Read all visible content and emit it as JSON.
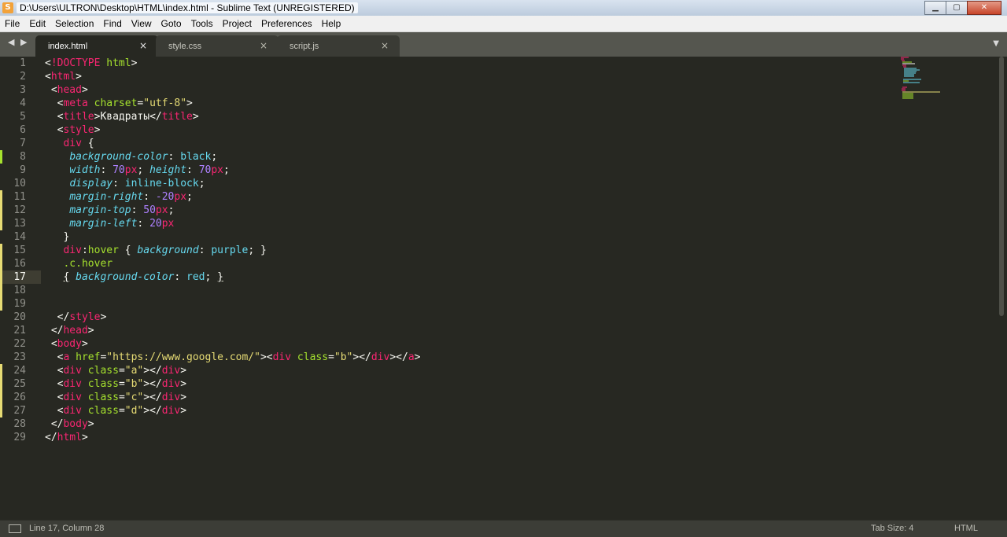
{
  "window": {
    "title": "D:\\Users\\ULTRON\\Desktop\\HTML\\index.html - Sublime Text (UNREGISTERED)",
    "minimize": "▁",
    "maximize": "▢",
    "close": "✕",
    "app_icon": "S"
  },
  "menu": [
    "File",
    "Edit",
    "Selection",
    "Find",
    "View",
    "Goto",
    "Tools",
    "Project",
    "Preferences",
    "Help"
  ],
  "tabs": [
    {
      "label": "index.html",
      "close": "×",
      "active": true
    },
    {
      "label": "style.css",
      "close": "×",
      "active": false
    },
    {
      "label": "script.js",
      "close": "×",
      "active": false
    }
  ],
  "tab_nav": "◀ ▶",
  "tab_dropdown": "▼",
  "editor": {
    "line_numbers": [
      "1",
      "2",
      "3",
      "4",
      "5",
      "6",
      "7",
      "8",
      "9",
      "10",
      "11",
      "12",
      "13",
      "14",
      "15",
      "16",
      "17",
      "18",
      "19",
      "20",
      "21",
      "22",
      "23",
      "24",
      "25",
      "26",
      "27",
      "28",
      "29"
    ],
    "current_line": 17,
    "modified_lines": [
      11,
      12,
      13,
      15,
      16,
      17,
      18,
      19,
      24,
      25,
      26,
      27
    ],
    "added_lines": [
      8
    ],
    "colors": {
      "background": "#272822",
      "tag": "#f92672",
      "string": "#e6db74",
      "attribute": "#a6e22e",
      "property": "#66d9ef",
      "number": "#ae81ff"
    }
  },
  "status": {
    "position": "Line 17, Column 28",
    "tab_size": "Tab Size: 4",
    "syntax": "HTML"
  }
}
